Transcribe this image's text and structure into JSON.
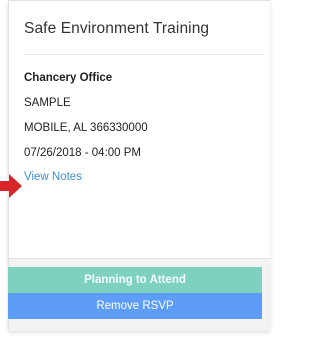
{
  "event": {
    "title": "Safe Environment Training",
    "organization": "Chancery Office",
    "location_name": "SAMPLE",
    "city_state_zip": "MOBILE, AL 366330000",
    "datetime": "07/26/2018 - 04:00 PM",
    "view_notes_label": "View Notes"
  },
  "actions": {
    "planning_label": "Planning to Attend",
    "remove_label": "Remove RSVP"
  },
  "colors": {
    "planning_button": "#7fd1bf",
    "remove_button": "#5d9df7",
    "link": "#3d8fd6",
    "arrow": "#d9262a"
  },
  "icons": {
    "pointer": "right-arrow-icon"
  }
}
